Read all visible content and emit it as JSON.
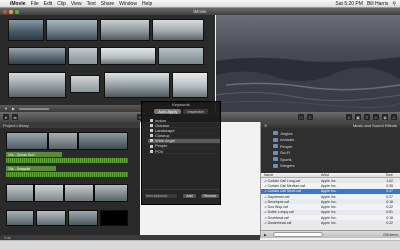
{
  "menubar": {
    "items": [
      "iMovie",
      "File",
      "Edit",
      "Clip",
      "View",
      "Text",
      "Share",
      "Window",
      "Help"
    ],
    "clock": "Sat 5:20 PM",
    "user": "Bill Harris"
  },
  "window": {
    "title": "iMovie"
  },
  "project": {
    "header": "Project Library",
    "clips": [
      "10s - Ocean Surf",
      "15s - Seagulls"
    ]
  },
  "hud": {
    "title": "Keywords",
    "tabs": [
      "Auto Apply",
      "Inspector"
    ],
    "keywords": [
      "Indoor",
      "Outdoor",
      "Landscape",
      "Closeup",
      "Wide Angle",
      "People",
      "POV"
    ],
    "new_keyword_placeholder": "New keyword",
    "add_label": "Add",
    "remove_label": "Remove"
  },
  "media": {
    "header_left": "Music and Sound Effects",
    "folders": [
      "Jingles",
      "Animals",
      "People",
      "Sci-Fi",
      "Sports",
      "Stingers"
    ],
    "columns": [
      "Name",
      "Artist",
      "Time"
    ],
    "rows": [
      {
        "name": "Curtain Call Long.caf",
        "artist": "Apple Inc.",
        "time": "1:02",
        "selected": false
      },
      {
        "name": "Curtain Call Medium.caf",
        "artist": "Apple Inc.",
        "time": "0:35",
        "selected": false
      },
      {
        "name": "Curtain Call Short.caf",
        "artist": "Apple Inc.",
        "time": "0:17",
        "selected": true
      },
      {
        "name": "Daydream.caf",
        "artist": "Apple Inc.",
        "time": "0:37",
        "selected": false
      },
      {
        "name": "Developer.caf",
        "artist": "Apple Inc.",
        "time": "0:18",
        "selected": false
      },
      {
        "name": "Doo Wop.caf",
        "artist": "Apple Inc.",
        "time": "0:22",
        "selected": false
      },
      {
        "name": "Dottie Lumpy.caf",
        "artist": "Apple Inc.",
        "time": "0:51",
        "selected": false
      },
      {
        "name": "Drumbeat.caf",
        "artist": "Apple Inc.",
        "time": "0:18",
        "selected": false
      },
      {
        "name": "Dusterhead.caf",
        "artist": "Apple Inc.",
        "time": "0:22",
        "selected": false
      }
    ],
    "count_label": "236 items"
  },
  "status": {
    "project_duration": "9.4s"
  },
  "colors": {
    "traffic_red": "#e0443e",
    "traffic_yellow": "#e5a52a",
    "traffic_green": "#58b040",
    "selection": "#3875d7"
  }
}
